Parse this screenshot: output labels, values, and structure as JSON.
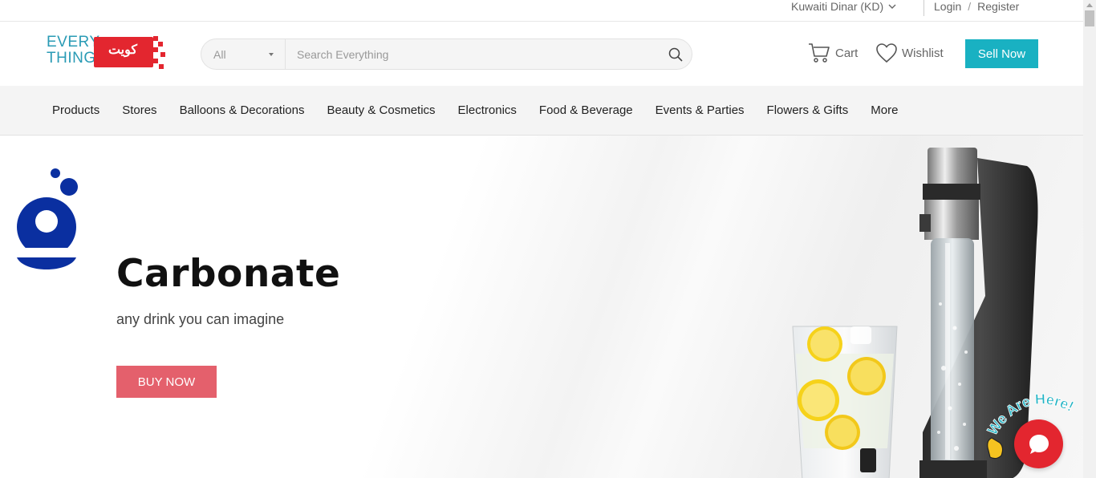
{
  "topbar": {
    "currency": "Kuwaiti Dinar (KD)",
    "login": "Login",
    "register": "Register",
    "separator": "/"
  },
  "header": {
    "logo": {
      "line1": "EVERY",
      "line2": "THING",
      "arabic": "كويت"
    },
    "search": {
      "category": "All",
      "placeholder": "Search Everything"
    },
    "cart_label": "Cart",
    "wishlist_label": "Wishlist",
    "sell_label": "Sell Now"
  },
  "nav": {
    "items": [
      "Products",
      "Stores",
      "Balloons & Decorations",
      "Beauty & Cosmetics",
      "Electronics",
      "Food & Beverage",
      "Events & Parties",
      "Flowers & Gifts",
      "More"
    ]
  },
  "hero": {
    "title": "Carbonate",
    "subtitle": "any drink you can imagine",
    "button": "BUY NOW"
  },
  "chat": {
    "tagline": "We Are Here!"
  },
  "colors": {
    "accent": "#19b1c2",
    "buy_button": "#e4606c",
    "brand_red": "#e3262f",
    "brand_blue": "#0a2fa0"
  },
  "icons": [
    "chevron-down-icon",
    "search-icon",
    "cart-icon",
    "heart-icon",
    "chat-icon",
    "wave-hand-icon"
  ]
}
